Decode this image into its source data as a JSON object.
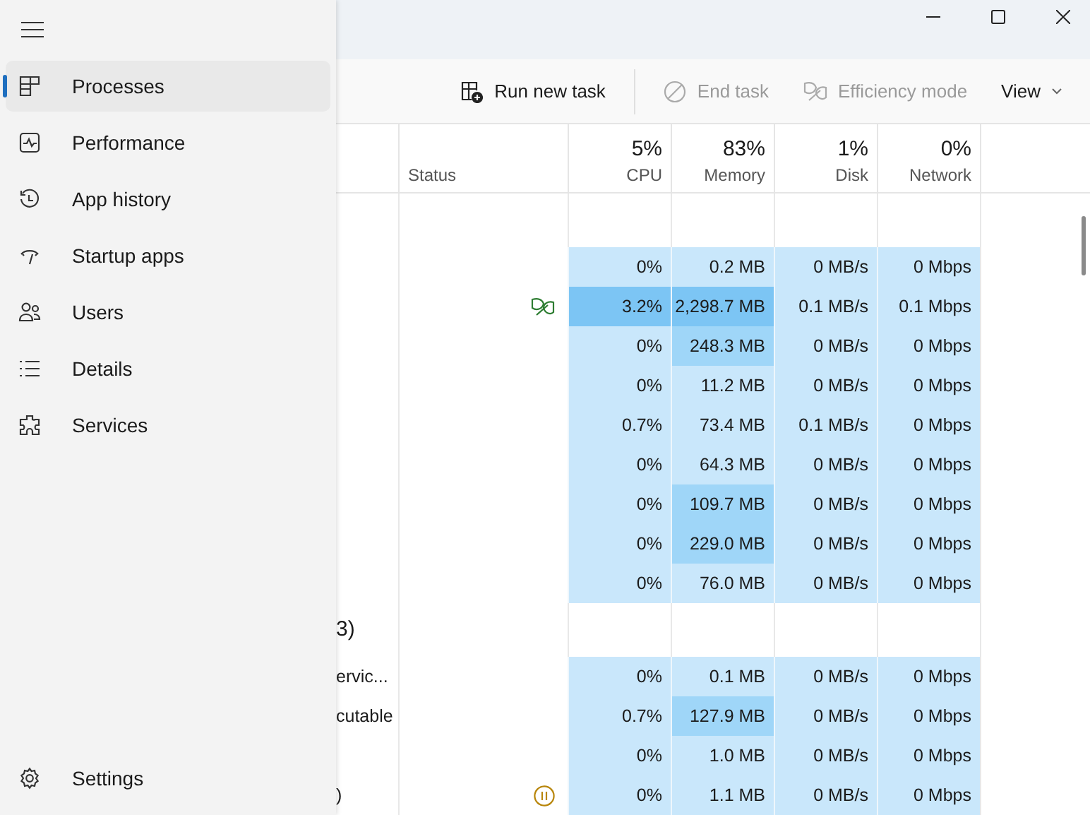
{
  "sidebar": {
    "items": [
      {
        "label": "Processes",
        "selected": true
      },
      {
        "label": "Performance",
        "selected": false
      },
      {
        "label": "App history",
        "selected": false
      },
      {
        "label": "Startup apps",
        "selected": false
      },
      {
        "label": "Users",
        "selected": false
      },
      {
        "label": "Details",
        "selected": false
      },
      {
        "label": "Services",
        "selected": false
      }
    ],
    "settings": {
      "label": "Settings"
    }
  },
  "toolbar": [
    {
      "label": "Run new task",
      "disabled": false
    },
    {
      "label": "End task",
      "disabled": true
    },
    {
      "label": "Efficiency mode",
      "disabled": true
    },
    {
      "label": "View",
      "disabled": false
    }
  ],
  "table": {
    "columns": [
      {
        "label": "Status"
      },
      {
        "total": "5%",
        "label": "CPU"
      },
      {
        "total": "83%",
        "label": "Memory"
      },
      {
        "total": "1%",
        "label": "Disk"
      },
      {
        "total": "0%",
        "label": "Network"
      }
    ],
    "groups": [
      {
        "rows": [
          {
            "cells": [
              {
                "text": "0%",
                "color": "#c9e7fb"
              },
              {
                "text": "0.2 MB",
                "color": "#c9e7fb"
              },
              {
                "text": "0 MB/s",
                "color": "#c9e7fb"
              },
              {
                "text": "0 Mbps",
                "color": "#c9e7fb"
              }
            ]
          },
          {
            "kind": "efficiency",
            "cells": [
              {
                "text": "3.2%",
                "color": "#7cc5f4"
              },
              {
                "text": "2,298.7 MB",
                "color": "#7cc5f4"
              },
              {
                "text": "0.1 MB/s",
                "color": "#c9e7fb"
              },
              {
                "text": "0.1 Mbps",
                "color": "#c9e7fb"
              }
            ]
          },
          {
            "cells": [
              {
                "text": "0%",
                "color": "#c9e7fb"
              },
              {
                "text": "248.3 MB",
                "color": "#9fd6f8"
              },
              {
                "text": "0 MB/s",
                "color": "#c9e7fb"
              },
              {
                "text": "0 Mbps",
                "color": "#c9e7fb"
              }
            ]
          },
          {
            "cells": [
              {
                "text": "0%",
                "color": "#c9e7fb"
              },
              {
                "text": "11.2 MB",
                "color": "#c9e7fb"
              },
              {
                "text": "0 MB/s",
                "color": "#c9e7fb"
              },
              {
                "text": "0 Mbps",
                "color": "#c9e7fb"
              }
            ]
          },
          {
            "cells": [
              {
                "text": "0.7%",
                "color": "#c9e7fb"
              },
              {
                "text": "73.4 MB",
                "color": "#c9e7fb"
              },
              {
                "text": "0.1 MB/s",
                "color": "#c9e7fb"
              },
              {
                "text": "0 Mbps",
                "color": "#c9e7fb"
              }
            ]
          },
          {
            "cells": [
              {
                "text": "0%",
                "color": "#c9e7fb"
              },
              {
                "text": "64.3 MB",
                "color": "#c9e7fb"
              },
              {
                "text": "0 MB/s",
                "color": "#c9e7fb"
              },
              {
                "text": "0 Mbps",
                "color": "#c9e7fb"
              }
            ]
          },
          {
            "cells": [
              {
                "text": "0%",
                "color": "#c9e7fb"
              },
              {
                "text": "109.7 MB",
                "color": "#9fd6f8"
              },
              {
                "text": "0 MB/s",
                "color": "#c9e7fb"
              },
              {
                "text": "0 Mbps",
                "color": "#c9e7fb"
              }
            ]
          },
          {
            "cells": [
              {
                "text": "0%",
                "color": "#c9e7fb"
              },
              {
                "text": "229.0 MB",
                "color": "#9fd6f8"
              },
              {
                "text": "0 MB/s",
                "color": "#c9e7fb"
              },
              {
                "text": "0 Mbps",
                "color": "#c9e7fb"
              }
            ]
          },
          {
            "cells": [
              {
                "text": "0%",
                "color": "#c9e7fb"
              },
              {
                "text": "76.0 MB",
                "color": "#c9e7fb"
              },
              {
                "text": "0 MB/s",
                "color": "#c9e7fb"
              },
              {
                "text": "0 Mbps",
                "color": "#c9e7fb"
              }
            ]
          }
        ]
      },
      {
        "label": "3)",
        "rows": [
          {
            "name": "ervic...",
            "cells": [
              {
                "text": "0%",
                "color": "#c9e7fb"
              },
              {
                "text": "0.1 MB",
                "color": "#c9e7fb"
              },
              {
                "text": "0 MB/s",
                "color": "#c9e7fb"
              },
              {
                "text": "0 Mbps",
                "color": "#c9e7fb"
              }
            ]
          },
          {
            "name": "cutable",
            "cells": [
              {
                "text": "0.7%",
                "color": "#c9e7fb"
              },
              {
                "text": "127.9 MB",
                "color": "#9fd6f8"
              },
              {
                "text": "0 MB/s",
                "color": "#c9e7fb"
              },
              {
                "text": "0 Mbps",
                "color": "#c9e7fb"
              }
            ]
          },
          {
            "cells": [
              {
                "text": "0%",
                "color": "#c9e7fb"
              },
              {
                "text": "1.0 MB",
                "color": "#c9e7fb"
              },
              {
                "text": "0 MB/s",
                "color": "#c9e7fb"
              },
              {
                "text": "0 Mbps",
                "color": "#c9e7fb"
              }
            ]
          },
          {
            "name": ")",
            "kind": "suspended",
            "cells": [
              {
                "text": "0%",
                "color": "#c9e7fb"
              },
              {
                "text": "1.1 MB",
                "color": "#c9e7fb"
              },
              {
                "text": "0 MB/s",
                "color": "#c9e7fb"
              },
              {
                "text": "0 Mbps",
                "color": "#c9e7fb"
              }
            ]
          }
        ]
      }
    ]
  }
}
